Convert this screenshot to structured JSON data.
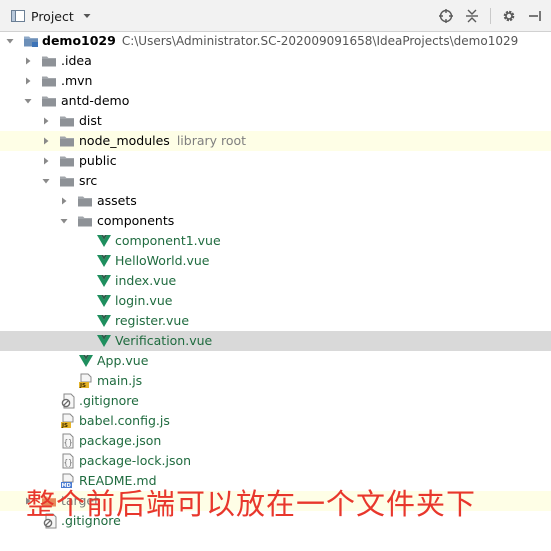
{
  "toolbar": {
    "title": "Project",
    "icons": [
      "project-view-icon",
      "chevron-down-icon",
      "locate-icon",
      "collapse-icon",
      "settings-gear-icon",
      "hide-panel-icon"
    ]
  },
  "tree": {
    "root": {
      "name": "demo1029",
      "path": "C:\\Users\\Administrator.SC-202009091658\\IdeaProjects\\demo1029"
    },
    "idea": ".idea",
    "mvn": ".mvn",
    "antd_demo": "antd-demo",
    "dist": "dist",
    "node_modules": "node_modules",
    "node_modules_extra": "library root",
    "public": "public",
    "src": "src",
    "assets": "assets",
    "components": "components",
    "component_files": [
      "component1.vue",
      "HelloWorld.vue",
      "index.vue",
      "login.vue",
      "register.vue",
      "Verification.vue"
    ],
    "app_vue": "App.vue",
    "main_js": "main.js",
    "gitignore": ".gitignore",
    "babel_config": "babel.config.js",
    "package_json": "package.json",
    "package_lock": "package-lock.json",
    "readme": "README.md",
    "target": "target",
    "gitignore2": ".gitignore"
  },
  "caption": "整个前后端可以放在一个文件夹下",
  "colors": {
    "vue_green": "#1f8f5e",
    "folder_gray": "#9aa0a6",
    "caption_red": "#e8372c",
    "selection_gray": "#d9d9d9",
    "highlight_yellow": "#fefee6"
  }
}
